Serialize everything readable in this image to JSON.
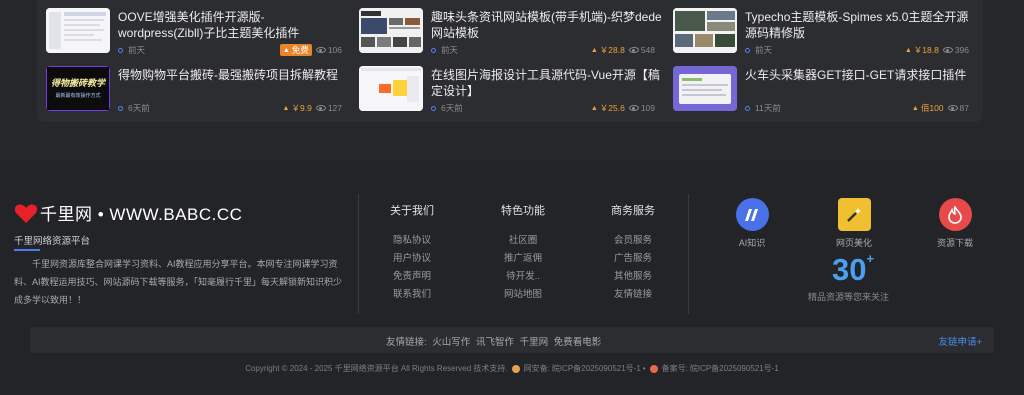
{
  "cards": [
    {
      "title": "OOVE增强美化插件开源版-wordpress(Zibll)子比主题美化插件",
      "time": "前天",
      "price": "免费",
      "views": "106"
    },
    {
      "title": "趣味头条资讯网站模板(带手机端)-织梦dede网站模板",
      "time": "前天",
      "price": "￥28.8",
      "views": "548"
    },
    {
      "title": "Typecho主题模板-Spimes x5.0主题全开源源码精修版",
      "time": "前天",
      "price": "￥18.8",
      "views": "396"
    },
    {
      "title": "得物购物平台搬砖-最强搬砖项目拆解教程",
      "time": "6天前",
      "price": "￥9.9",
      "views": "127",
      "thumb_text": "得物搬砖教学",
      "thumb_sub": "最新最有效操作方式"
    },
    {
      "title": "在线图片海报设计工具源代码-Vue开源【稿定设计】",
      "time": "6天前",
      "price": "￥25.6",
      "views": "109"
    },
    {
      "title": "火车头采集器GET接口-GET请求接口插件",
      "time": "11天前",
      "price": "佰100",
      "views": "87"
    }
  ],
  "footer": {
    "brand_name": "千里网 • WWW.BABC.CC",
    "brand_sub": "千里网络资源平台",
    "description": "千里网资源库整合网课学习资料、AI教程应用分享平台。本网专注网课学习资料、AI教程运用技巧、网站源码下载等服务，「知毫履行千里」每天解锁新知识积少成多学以致用！！",
    "columns": [
      {
        "heading": "关于我们",
        "links": [
          "隐私协议",
          "用户协议",
          "免责声明",
          "联系我们"
        ]
      },
      {
        "heading": "特色功能",
        "links": [
          "社区圈",
          "推广返佣",
          "待开发..",
          "网站地图"
        ]
      },
      {
        "heading": "商务服务",
        "links": [
          "会员服务",
          "广告服务",
          "其他服务",
          "友情链接"
        ]
      }
    ],
    "features": [
      {
        "label": "AI知识",
        "icon": "ai-knowledge-icon",
        "color": "#4a72e8"
      },
      {
        "label": "网页美化",
        "icon": "magic-wand-icon",
        "color": "#f0c030"
      },
      {
        "label": "资源下载",
        "icon": "fire-icon",
        "color": "#e84a4a"
      }
    ],
    "big_number": "30",
    "big_plus": "+",
    "big_sub": "精品资源等您来关注",
    "friend_links_label": "友情链接:",
    "friend_links": [
      "火山写作",
      "讯飞智作",
      "千里网",
      "免费看电影"
    ],
    "apply_label": "友链申请+",
    "copyright": "Copyright © 2024 - 2025 千里网络资源平台 All Rights Reserved 技术支持.",
    "police_label": "网安备:",
    "police_no": "皖ICP备2025090521号-1",
    "icp_label": "备案号:",
    "icp_no": "皖ICP备2025090521号-1",
    "sep": "•"
  }
}
